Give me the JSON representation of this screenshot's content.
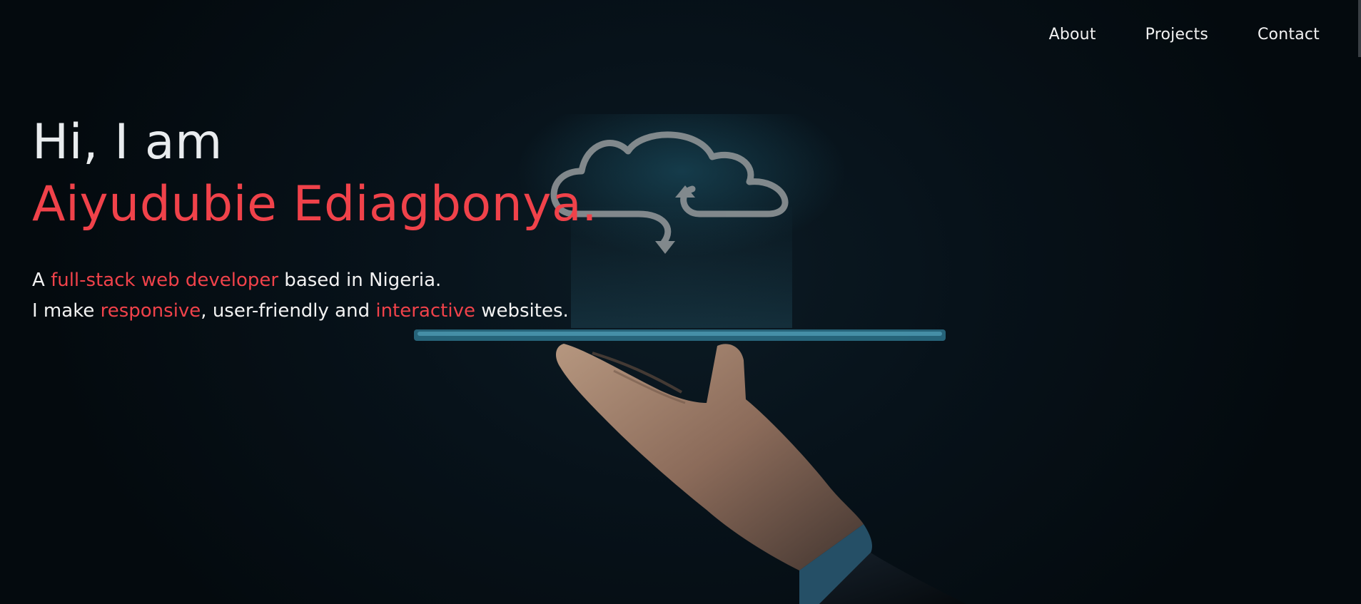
{
  "nav": {
    "items": [
      {
        "label": "About"
      },
      {
        "label": "Projects"
      },
      {
        "label": "Contact"
      }
    ]
  },
  "hero": {
    "greeting": "Hi, I am",
    "name": "Aiyudubie Ediagbonya.",
    "line1": {
      "prefix": "A ",
      "highlight": "full-stack web developer",
      "suffix": " based in Nigeria."
    },
    "line2": {
      "prefix": "I make ",
      "highlight1": "responsive",
      "middle": ", user-friendly and ",
      "highlight2": "interactive",
      "suffix": " websites."
    }
  },
  "colors": {
    "accent": "#f0424a",
    "text": "#f2f2f2",
    "background": "#050b10"
  },
  "icons": [
    "cloud-sync-icon",
    "tablet-illustration",
    "hand-illustration"
  ]
}
